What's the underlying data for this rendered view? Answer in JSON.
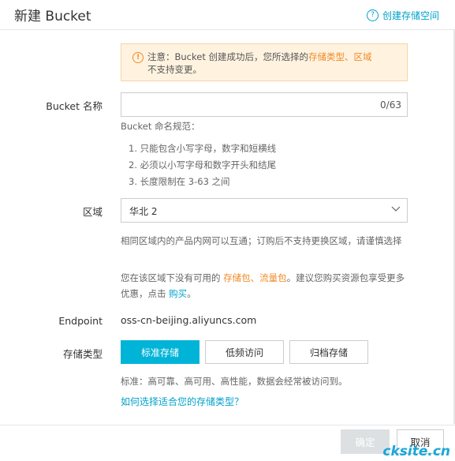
{
  "header": {
    "title": "新建 Bucket",
    "help_label": "创建存储空间"
  },
  "notice": {
    "prefix": "注意：Bucket 创建成功后，您所选择的",
    "link1": "存储类型",
    "sep": "、",
    "link2": "区域",
    "suffix": "不支持变更。"
  },
  "bucket_name": {
    "label": "Bucket 名称",
    "value": "",
    "counter": "0/63",
    "rules_title": "Bucket 命名规范：",
    "rules": [
      "1. 只能包含小写字母，数字和短横线",
      "2. 必须以小写字母和数字开头和结尾",
      "3. 长度限制在 3-63 之间"
    ]
  },
  "region": {
    "label": "区域",
    "selected": "华北 2",
    "hint": "相同区域内的产品内网可以互通；订购后不支持更换区域，请谨慎选择",
    "pkg_prefix": "您在该区域下没有可用的",
    "pkg_link1": "存储包",
    "pkg_sep": "、",
    "pkg_link2": "流量包",
    "pkg_mid": "。建议您购买资源包享受更多优惠，点击",
    "pkg_buy": "购买",
    "pkg_suffix": "。"
  },
  "endpoint": {
    "label": "Endpoint",
    "value": "oss-cn-beijing.aliyuncs.com"
  },
  "storage_type": {
    "label": "存储类型",
    "options": [
      "标准存储",
      "低频访问",
      "归档存储"
    ],
    "selected_index": 0,
    "desc": "标准：高可靠、高可用、高性能，数据会经常被访问到。",
    "help_link": "如何选择适合您的存储类型？"
  },
  "footer": {
    "ok_label": "确定",
    "cancel_label": "取消"
  },
  "watermark": "cksite.cn",
  "colors": {
    "accent": "#00b4d8",
    "link": "#00a2ca",
    "warning": "#f08a24",
    "notice_bg": "#fff3e0"
  }
}
